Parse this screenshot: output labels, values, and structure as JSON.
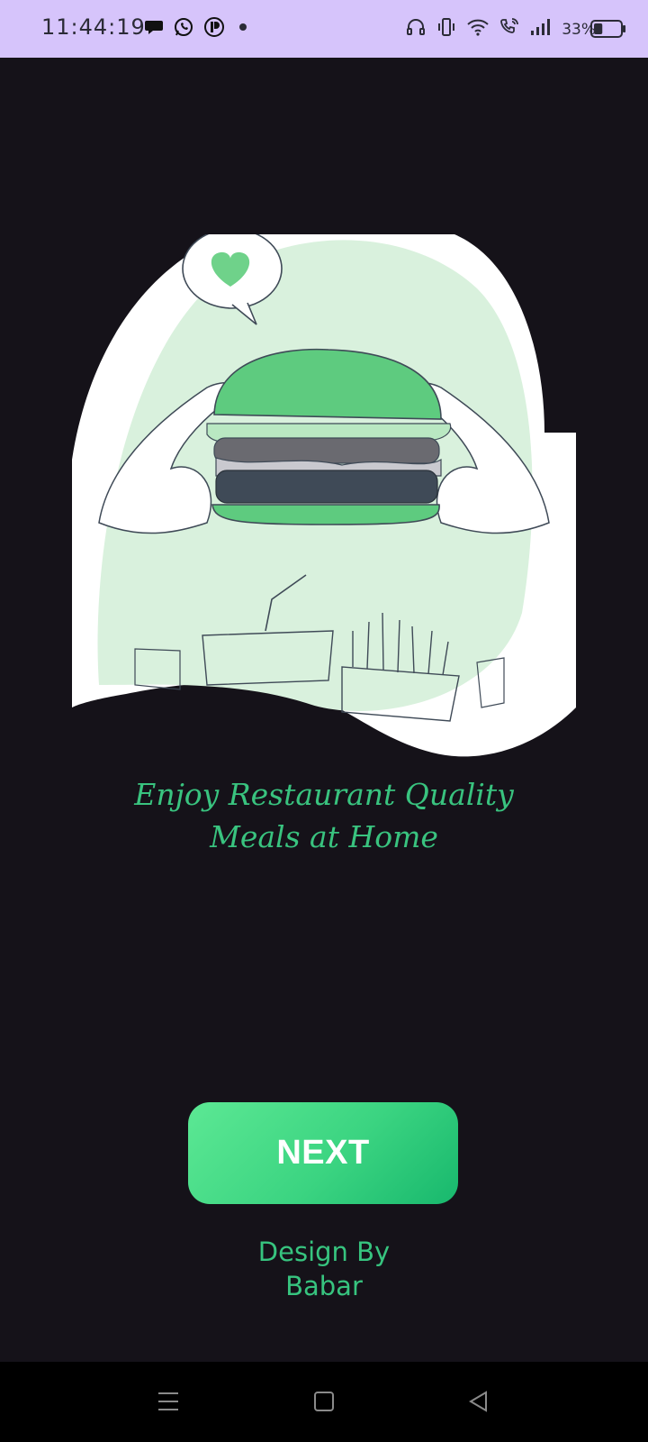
{
  "status_bar": {
    "time": "11:44:19",
    "battery_percent": "33%",
    "battery_level": 0.33,
    "notification_icons": [
      "chat-bubble-icon",
      "whatsapp-icon",
      "app-icon",
      "dot-icon"
    ],
    "system_icons": [
      "headset-icon",
      "vibrate-icon",
      "wifi-icon",
      "wifi-call-icon",
      "signal-icon",
      "battery-icon"
    ]
  },
  "illustration": {
    "icons": [
      "burger-illustration",
      "heart-icon",
      "drink-cup",
      "french-fries"
    ],
    "colors": {
      "green": "#5ecb7f",
      "light_green": "#d9f1dd",
      "dark": "#3f4a57"
    }
  },
  "onboarding": {
    "headline_line1": "Enjoy Restaurant Quality",
    "headline_line2": "Meals at Home",
    "next_label": "NEXT",
    "credit_line1": "Design By",
    "credit_line2": "Babar"
  },
  "nav_bar": {
    "buttons": [
      "menu-icon",
      "home-icon",
      "back-icon"
    ]
  },
  "colors": {
    "background": "#151219",
    "status_bar": "#d6c4fb",
    "accent": "#39c37f",
    "button_gradient_start": "#5ce894",
    "button_gradient_end": "#18b86d"
  }
}
